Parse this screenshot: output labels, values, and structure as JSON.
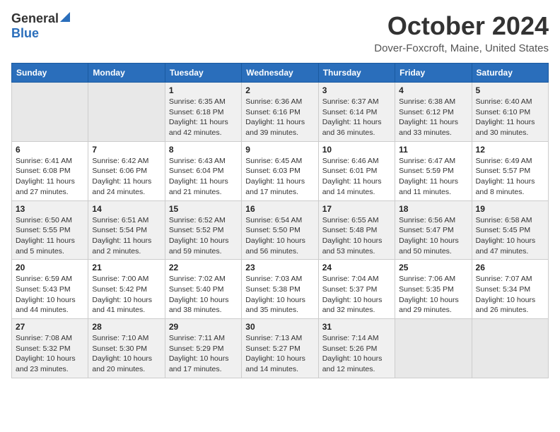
{
  "header": {
    "logo_general": "General",
    "logo_blue": "Blue",
    "month": "October 2024",
    "location": "Dover-Foxcroft, Maine, United States"
  },
  "weekdays": [
    "Sunday",
    "Monday",
    "Tuesday",
    "Wednesday",
    "Thursday",
    "Friday",
    "Saturday"
  ],
  "weeks": [
    [
      {
        "day": "",
        "detail": ""
      },
      {
        "day": "",
        "detail": ""
      },
      {
        "day": "1",
        "detail": "Sunrise: 6:35 AM\nSunset: 6:18 PM\nDaylight: 11 hours and 42 minutes."
      },
      {
        "day": "2",
        "detail": "Sunrise: 6:36 AM\nSunset: 6:16 PM\nDaylight: 11 hours and 39 minutes."
      },
      {
        "day": "3",
        "detail": "Sunrise: 6:37 AM\nSunset: 6:14 PM\nDaylight: 11 hours and 36 minutes."
      },
      {
        "day": "4",
        "detail": "Sunrise: 6:38 AM\nSunset: 6:12 PM\nDaylight: 11 hours and 33 minutes."
      },
      {
        "day": "5",
        "detail": "Sunrise: 6:40 AM\nSunset: 6:10 PM\nDaylight: 11 hours and 30 minutes."
      }
    ],
    [
      {
        "day": "6",
        "detail": "Sunrise: 6:41 AM\nSunset: 6:08 PM\nDaylight: 11 hours and 27 minutes."
      },
      {
        "day": "7",
        "detail": "Sunrise: 6:42 AM\nSunset: 6:06 PM\nDaylight: 11 hours and 24 minutes."
      },
      {
        "day": "8",
        "detail": "Sunrise: 6:43 AM\nSunset: 6:04 PM\nDaylight: 11 hours and 21 minutes."
      },
      {
        "day": "9",
        "detail": "Sunrise: 6:45 AM\nSunset: 6:03 PM\nDaylight: 11 hours and 17 minutes."
      },
      {
        "day": "10",
        "detail": "Sunrise: 6:46 AM\nSunset: 6:01 PM\nDaylight: 11 hours and 14 minutes."
      },
      {
        "day": "11",
        "detail": "Sunrise: 6:47 AM\nSunset: 5:59 PM\nDaylight: 11 hours and 11 minutes."
      },
      {
        "day": "12",
        "detail": "Sunrise: 6:49 AM\nSunset: 5:57 PM\nDaylight: 11 hours and 8 minutes."
      }
    ],
    [
      {
        "day": "13",
        "detail": "Sunrise: 6:50 AM\nSunset: 5:55 PM\nDaylight: 11 hours and 5 minutes."
      },
      {
        "day": "14",
        "detail": "Sunrise: 6:51 AM\nSunset: 5:54 PM\nDaylight: 11 hours and 2 minutes."
      },
      {
        "day": "15",
        "detail": "Sunrise: 6:52 AM\nSunset: 5:52 PM\nDaylight: 10 hours and 59 minutes."
      },
      {
        "day": "16",
        "detail": "Sunrise: 6:54 AM\nSunset: 5:50 PM\nDaylight: 10 hours and 56 minutes."
      },
      {
        "day": "17",
        "detail": "Sunrise: 6:55 AM\nSunset: 5:48 PM\nDaylight: 10 hours and 53 minutes."
      },
      {
        "day": "18",
        "detail": "Sunrise: 6:56 AM\nSunset: 5:47 PM\nDaylight: 10 hours and 50 minutes."
      },
      {
        "day": "19",
        "detail": "Sunrise: 6:58 AM\nSunset: 5:45 PM\nDaylight: 10 hours and 47 minutes."
      }
    ],
    [
      {
        "day": "20",
        "detail": "Sunrise: 6:59 AM\nSunset: 5:43 PM\nDaylight: 10 hours and 44 minutes."
      },
      {
        "day": "21",
        "detail": "Sunrise: 7:00 AM\nSunset: 5:42 PM\nDaylight: 10 hours and 41 minutes."
      },
      {
        "day": "22",
        "detail": "Sunrise: 7:02 AM\nSunset: 5:40 PM\nDaylight: 10 hours and 38 minutes."
      },
      {
        "day": "23",
        "detail": "Sunrise: 7:03 AM\nSunset: 5:38 PM\nDaylight: 10 hours and 35 minutes."
      },
      {
        "day": "24",
        "detail": "Sunrise: 7:04 AM\nSunset: 5:37 PM\nDaylight: 10 hours and 32 minutes."
      },
      {
        "day": "25",
        "detail": "Sunrise: 7:06 AM\nSunset: 5:35 PM\nDaylight: 10 hours and 29 minutes."
      },
      {
        "day": "26",
        "detail": "Sunrise: 7:07 AM\nSunset: 5:34 PM\nDaylight: 10 hours and 26 minutes."
      }
    ],
    [
      {
        "day": "27",
        "detail": "Sunrise: 7:08 AM\nSunset: 5:32 PM\nDaylight: 10 hours and 23 minutes."
      },
      {
        "day": "28",
        "detail": "Sunrise: 7:10 AM\nSunset: 5:30 PM\nDaylight: 10 hours and 20 minutes."
      },
      {
        "day": "29",
        "detail": "Sunrise: 7:11 AM\nSunset: 5:29 PM\nDaylight: 10 hours and 17 minutes."
      },
      {
        "day": "30",
        "detail": "Sunrise: 7:13 AM\nSunset: 5:27 PM\nDaylight: 10 hours and 14 minutes."
      },
      {
        "day": "31",
        "detail": "Sunrise: 7:14 AM\nSunset: 5:26 PM\nDaylight: 10 hours and 12 minutes."
      },
      {
        "day": "",
        "detail": ""
      },
      {
        "day": "",
        "detail": ""
      }
    ]
  ]
}
